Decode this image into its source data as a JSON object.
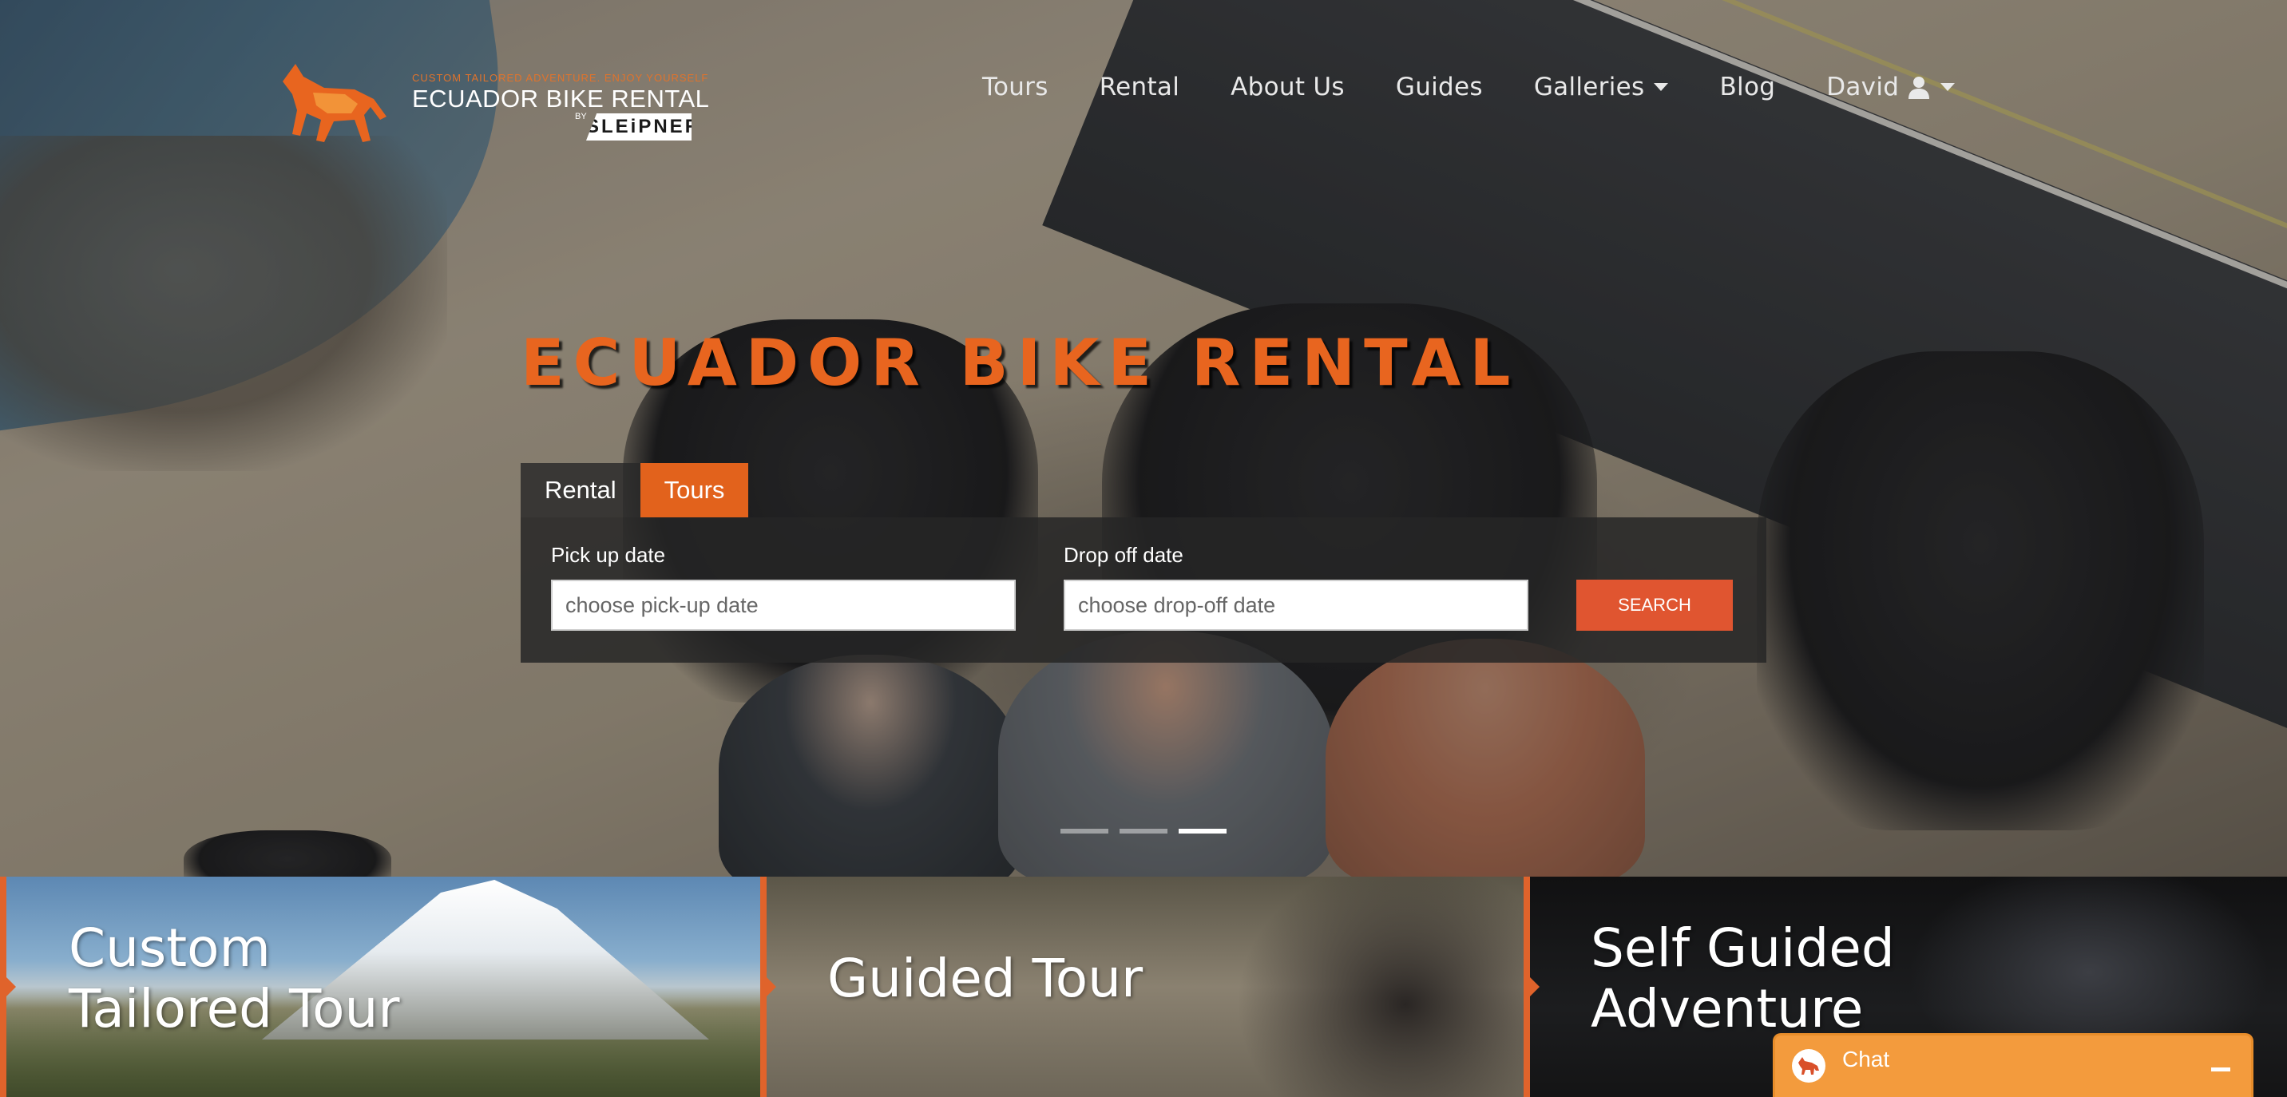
{
  "logo": {
    "tagline": "CUSTOM TAILORED ADVENTURE. ENJOY YOURSELF",
    "brand": "ECUADOR BIKE RENTAL",
    "by": "BY",
    "sub": "SLEiPNER"
  },
  "nav": {
    "items": [
      {
        "label": "Tours"
      },
      {
        "label": "Rental"
      },
      {
        "label": "About Us"
      },
      {
        "label": "Guides"
      },
      {
        "label": "Galleries",
        "dropdown": true
      },
      {
        "label": "Blog"
      },
      {
        "label": "David",
        "icon": "user-icon",
        "dropdown": true
      }
    ]
  },
  "hero": {
    "title": "ECUADOR BIKE RENTAL",
    "slides": {
      "count": 3,
      "active": 3
    }
  },
  "booking": {
    "tabs": [
      {
        "label": "Rental",
        "active": true
      },
      {
        "label": "Tours",
        "active": false
      }
    ],
    "pickup": {
      "label": "Pick up date",
      "placeholder": "choose pick-up date"
    },
    "dropoff": {
      "label": "Drop off date",
      "placeholder": "choose drop-off date"
    },
    "search_label": "SEARCH"
  },
  "cards": [
    {
      "line1": "Custom",
      "line2": "Tailored Tour"
    },
    {
      "line1": "Guided Tour",
      "line2": ""
    },
    {
      "line1": "Self Guided",
      "line2": "Adventure"
    }
  ],
  "chat": {
    "label": "Chat",
    "icon": "horse-icon"
  },
  "colors": {
    "accent": "#e2621c",
    "search_button": "#e05530",
    "chat": "#f39b3d"
  }
}
